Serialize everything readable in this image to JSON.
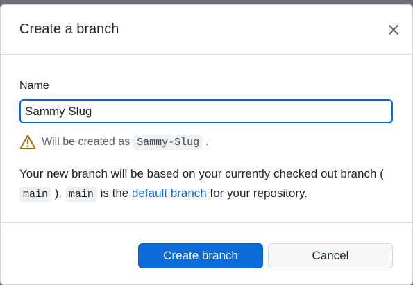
{
  "dialog": {
    "title": "Create a branch",
    "close_icon": "close-icon"
  },
  "form": {
    "name_label": "Name",
    "name_value": "Sammy Slug",
    "warning_prefix": "Will be created as",
    "warning_branch": "Sammy-Slug",
    "warning_suffix": ".",
    "warning_icon": "warning-icon"
  },
  "description": {
    "line_part1": "Your new branch will be based on your currently checked out branch (",
    "current_branch": "main",
    "line_part2": ").",
    "default_branch": "main",
    "line_part3": "is the",
    "link_text": "default branch",
    "line_part4": "for your repository."
  },
  "buttons": {
    "create_label": "Create branch",
    "cancel_label": "Cancel"
  },
  "colors": {
    "accent": "#0969da",
    "primary_button": "#0b6bd8",
    "warning": "#9a6700"
  }
}
